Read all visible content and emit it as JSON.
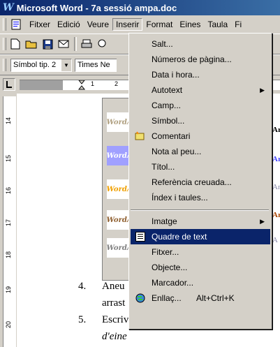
{
  "window": {
    "title": "Microsoft Word - 7a sessió ampa.doc",
    "logo": "W"
  },
  "menubar": {
    "items": [
      {
        "label": "Fitxer",
        "key": "F"
      },
      {
        "label": "Edició",
        "key": "E"
      },
      {
        "label": "Veure",
        "key": "V"
      },
      {
        "label": "Inserir",
        "key": "I",
        "open": true
      },
      {
        "label": "Format",
        "key": "o"
      },
      {
        "label": "Eines",
        "key": "n"
      },
      {
        "label": "Taula",
        "key": "T"
      },
      {
        "label": "Fi",
        "key": ""
      }
    ]
  },
  "formatting": {
    "style_value": "Símbol tip. 2",
    "font_value": "Times Ne"
  },
  "ruler": {
    "h_numbers": [
      "1",
      "2"
    ],
    "v_numbers": [
      "14",
      "15",
      "16",
      "17",
      "18",
      "19",
      "20"
    ]
  },
  "wordart": {
    "item_label": "WordArt"
  },
  "document": {
    "lines": [
      {
        "num": "4.",
        "text": "Aneu"
      },
      {
        "num": "",
        "text": "arrast"
      },
      {
        "num": "5.",
        "text": "Escriv"
      },
      {
        "num": "",
        "text": "d'eine"
      }
    ],
    "right_fragments": [
      "Ar",
      "Ar",
      "Ar",
      "Ar",
      "A"
    ]
  },
  "insert_menu": {
    "items": [
      {
        "label": "Salt...",
        "type": "item",
        "icon": ""
      },
      {
        "label": "Números de pàgina...",
        "type": "item",
        "icon": ""
      },
      {
        "label": "Data i hora...",
        "type": "item",
        "icon": ""
      },
      {
        "label": "Autotext",
        "type": "submenu",
        "icon": ""
      },
      {
        "label": "Camp...",
        "type": "item",
        "icon": ""
      },
      {
        "label": "Símbol...",
        "type": "item",
        "icon": ""
      },
      {
        "label": "Comentari",
        "type": "item",
        "icon": "comment-icon"
      },
      {
        "label": "Nota al peu...",
        "type": "item",
        "icon": ""
      },
      {
        "label": "Títol...",
        "type": "item",
        "icon": ""
      },
      {
        "label": "Referència creuada...",
        "type": "item",
        "icon": ""
      },
      {
        "label": "Índex i taules...",
        "type": "item",
        "icon": ""
      },
      {
        "label": "",
        "type": "separator"
      },
      {
        "label": "Imatge",
        "type": "submenu",
        "icon": ""
      },
      {
        "label": "Quadre de text",
        "type": "item",
        "icon": "textbox-icon",
        "highlighted": true
      },
      {
        "label": "Fitxer...",
        "type": "item",
        "icon": ""
      },
      {
        "label": "Objecte...",
        "type": "item",
        "icon": ""
      },
      {
        "label": "Marcador...",
        "type": "item",
        "icon": ""
      },
      {
        "label": "Enllaç...",
        "type": "item",
        "icon": "globe-link-icon",
        "shortcut": "Alt+Ctrl+K"
      }
    ]
  },
  "colors": {
    "title_bar": "#0a246a",
    "highlight": "#0a246a",
    "chrome": "#d4d0c8"
  }
}
